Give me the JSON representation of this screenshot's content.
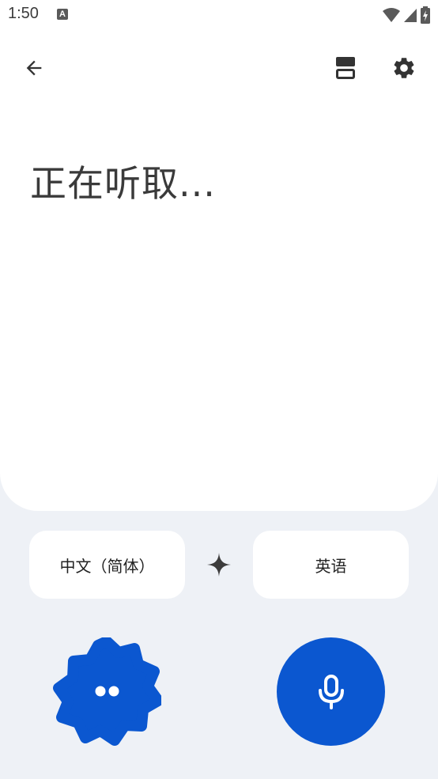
{
  "status_bar": {
    "time": "1:50",
    "notification_letter": "A"
  },
  "main": {
    "listening_text": "正在听取..."
  },
  "languages": {
    "source": "中文（简体）",
    "target": "英语"
  },
  "colors": {
    "accent": "#0b57d0",
    "background": "#eef1f6",
    "panel": "#ffffff",
    "text": "#3a3a3a"
  },
  "icons": {
    "back": "arrow-left-icon",
    "layout": "split-layout-icon",
    "settings": "gear-icon",
    "swap": "sparkle-icon",
    "conversation": "dots-icon",
    "mic": "microphone-icon"
  }
}
